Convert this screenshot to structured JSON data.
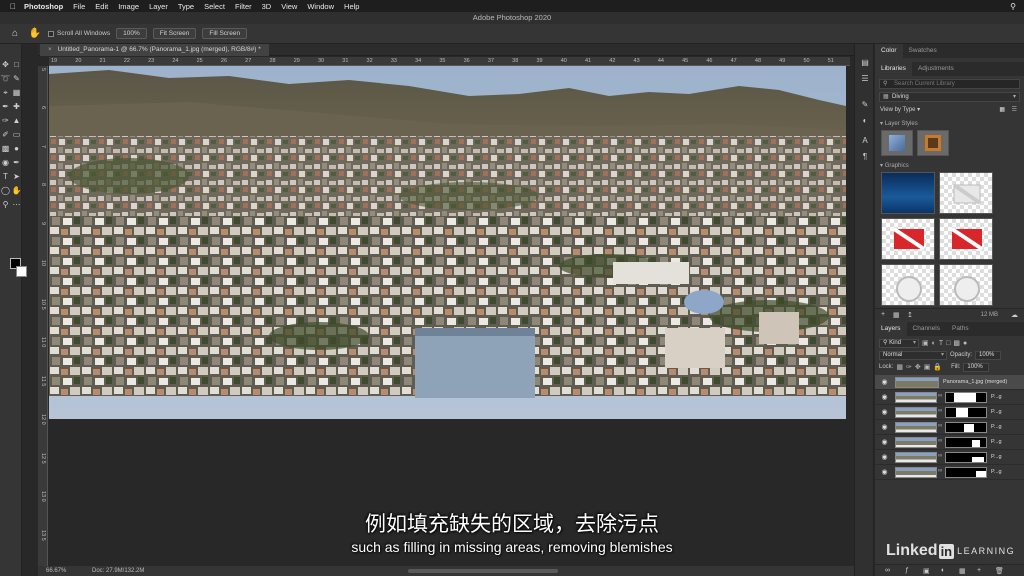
{
  "menubar": {
    "apple_icon": "apple-icon",
    "items": [
      "Photoshop",
      "File",
      "Edit",
      "Image",
      "Layer",
      "Type",
      "Select",
      "Filter",
      "3D",
      "View",
      "Window",
      "Help"
    ],
    "right_icon": "search-icon"
  },
  "window": {
    "title": "Adobe Photoshop 2020"
  },
  "options_bar": {
    "home_icon": "home-icon",
    "hand_icon": "hand-tool-icon",
    "scroll_all_windows": "Scroll All Windows",
    "zoom_100": "100%",
    "fit_screen": "Fit Screen",
    "fill_screen": "Fill Screen"
  },
  "document": {
    "tab_title": "Untitled_Panorama-1 @ 66.7% (Panorama_1.jpg (merged), RGB/8#) *",
    "close_glyph": "×"
  },
  "rulers": {
    "horizontal": [
      "19",
      "20",
      "21",
      "22",
      "23",
      "24",
      "25",
      "26",
      "27",
      "28",
      "29",
      "30",
      "31",
      "32",
      "33",
      "34",
      "35",
      "36",
      "37",
      "38",
      "39",
      "40",
      "41",
      "42",
      "43",
      "44",
      "45",
      "46",
      "47",
      "48",
      "49",
      "50",
      "51"
    ],
    "vertical": [
      "5",
      "6",
      "7",
      "8",
      "9",
      "10",
      "10 5",
      "11 0",
      "11 5",
      "12 0",
      "12 5",
      "13 0",
      "13 5"
    ]
  },
  "status_bar": {
    "zoom": "66.67%",
    "doc": "Doc: 27.9M/132.2M"
  },
  "panels": {
    "top_tabs": [
      "Color",
      "Swatches"
    ],
    "library_tabs": [
      "Libraries",
      "Adjustments"
    ],
    "library_search_placeholder": "Search Current Library",
    "library_name": "Diving",
    "view_by": "View by Type",
    "layer_styles_header": "Layer Styles",
    "graphics_header": "Graphics",
    "library_size": "12 MB"
  },
  "layers_panel": {
    "tabs": [
      "Layers",
      "Channels",
      "Paths"
    ],
    "kind_label": "Kind",
    "blend_mode": "Normal",
    "opacity_label": "Opacity:",
    "opacity_value": "100%",
    "lock_label": "Lock:",
    "fill_label": "Fill:",
    "fill_value": "100%",
    "layers": [
      {
        "name": "Panorama_1.jpg (merged)",
        "selected": true
      },
      {
        "name": "P...g",
        "selected": false
      },
      {
        "name": "P...g",
        "selected": false
      },
      {
        "name": "P...g",
        "selected": false
      },
      {
        "name": "P...g",
        "selected": false
      },
      {
        "name": "P...g",
        "selected": false
      },
      {
        "name": "P...g",
        "selected": false
      }
    ]
  },
  "subtitles": {
    "chinese": "例如填充缺失的区域，去除污点",
    "english": "such as filling in missing areas, removing blemishes"
  },
  "watermark": {
    "part1": "Linked",
    "part2": "in",
    "part3": "LEARNING"
  },
  "colors": {
    "foreground": "#000000",
    "background": "#ffffff",
    "ui_dark": "#282828",
    "panel": "#353535"
  }
}
